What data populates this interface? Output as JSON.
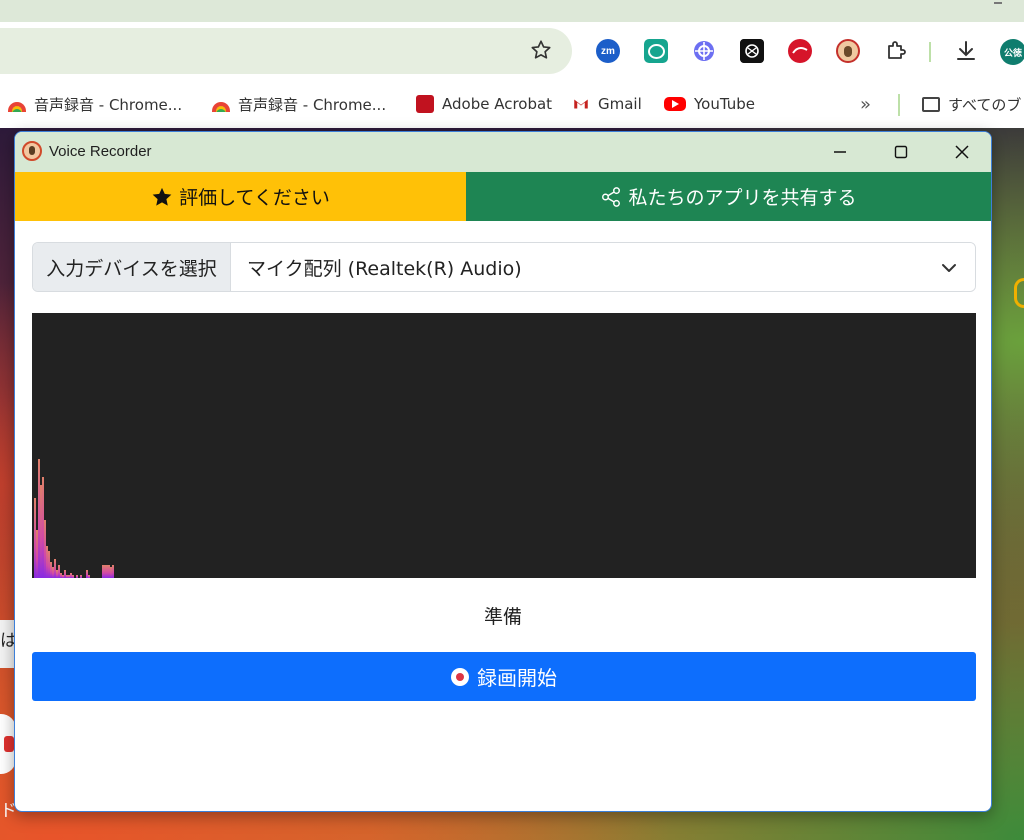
{
  "browser": {
    "bookmarks": [
      {
        "label": "音声録音 - Chrome...",
        "icon": "rainbow-icon"
      },
      {
        "label": "音声録音 - Chrome...",
        "icon": "rainbow-icon"
      },
      {
        "label": "Adobe Acrobat",
        "icon": "acrobat-icon"
      },
      {
        "label": "Gmail",
        "icon": "gmail-icon"
      },
      {
        "label": "YouTube",
        "icon": "youtube-icon"
      }
    ],
    "more_label": "»",
    "all_bookmarks_label": "すべてのブック",
    "profile_initials": "公徳",
    "extensions": [
      "zoom-icon",
      "chat-icon",
      "crosshair-icon",
      "openai-icon",
      "trend-micro-icon",
      "voice-recorder-icon",
      "puzzle-icon",
      "download-icon"
    ],
    "zoom_text": "zm"
  },
  "background": {
    "snippet_a": "は",
    "snippet_b": "ド"
  },
  "window": {
    "title": "Voice Recorder",
    "rate_label": "評価してください",
    "share_label": "私たちのアプリを共有する",
    "device_label": "入力デバイスを選択",
    "device_value": "マイク配列 (Realtek(R) Audio)",
    "status": "準備",
    "record_label": "録画開始"
  },
  "visualizer": {
    "levels": [
      0.3,
      0.18,
      0.45,
      0.35,
      0.38,
      0.22,
      0.12,
      0.1,
      0.06,
      0.04,
      0.07,
      0.03,
      0.05,
      0.02,
      0.01,
      0.03,
      0.01,
      0.01,
      0.02,
      0.01,
      0.0,
      0.01,
      0.0,
      0.01,
      0.0,
      0.0,
      0.03,
      0.01,
      0.0,
      0.0,
      0.0,
      0.0,
      0.0,
      0.0,
      0.05,
      0.05,
      0.05,
      0.05,
      0.04,
      0.05
    ],
    "colors": {
      "low": "#8a2be2",
      "mid": "#d24aa5",
      "high": "#e0806a"
    }
  }
}
